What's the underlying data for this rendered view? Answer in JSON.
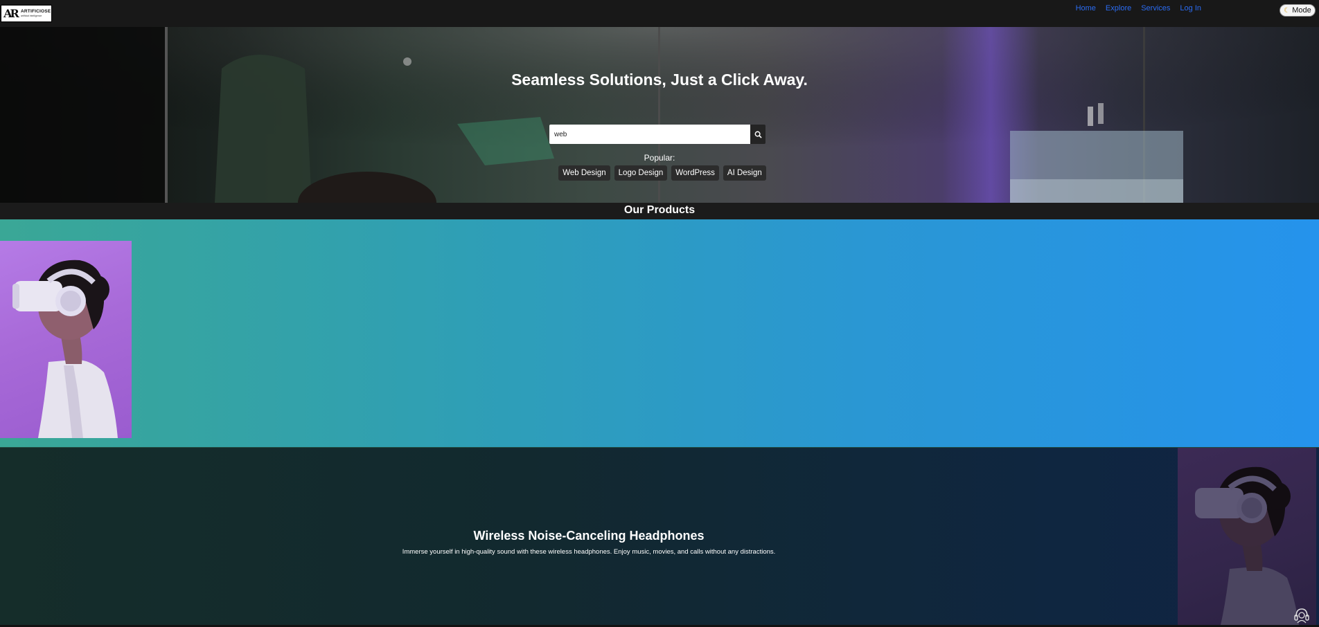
{
  "navbar": {
    "logo": {
      "name": "ARTIFICIOSE",
      "tagline": "artificial intelligence",
      "mark": "AR"
    },
    "links": [
      {
        "label": "Home"
      },
      {
        "label": "Explore"
      },
      {
        "label": "Services"
      },
      {
        "label": "Log In"
      }
    ],
    "mode_button": {
      "label": "Mode",
      "icon": "moon-icon"
    },
    "link_color": "#2b6cf2"
  },
  "hero": {
    "title": "Seamless Solutions, Just a Click Away.",
    "search": {
      "value": "web",
      "icon": "search-icon"
    },
    "popular_label": "Popular:",
    "tags": [
      "Web Design",
      "Logo Design",
      "WordPress",
      "AI Design"
    ]
  },
  "products": {
    "heading": "Our Products",
    "items": [
      {
        "image": "vr-headset-woman-purple"
      },
      {
        "title": "Wireless Noise-Canceling Headphones",
        "description": "Immerse yourself in high-quality sound with these wireless headphones. Enjoy music, movies, and calls without any distractions.",
        "image": "vr-headset-woman-dark"
      }
    ]
  },
  "support": {
    "icon": "headset-support-icon"
  }
}
